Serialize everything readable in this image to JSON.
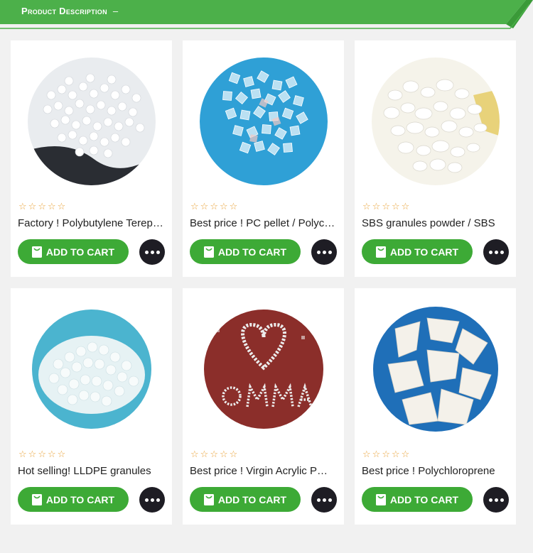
{
  "header": {
    "title": "Product Description",
    "toggle": "–"
  },
  "products": [
    {
      "title": "Factory ! Polybutylene Terephthalate",
      "rating": 0,
      "cart_label": "ADD TO CART",
      "image": "white-pellets"
    },
    {
      "title": "Best price ! PC pellet / Polycarbonate",
      "rating": 0,
      "cart_label": "ADD TO CART",
      "image": "clear-pellets-blue"
    },
    {
      "title": "SBS granules powder / SBS",
      "rating": 0,
      "cart_label": "ADD TO CART",
      "image": "white-crumbs-yellow"
    },
    {
      "title": "Hot selling! LLDPE granules",
      "rating": 0,
      "cart_label": "ADD TO CART",
      "image": "translucent-beads-teal"
    },
    {
      "title": "Best price ! Virgin Acrylic PMMA",
      "rating": 0,
      "cart_label": "ADD TO CART",
      "image": "pmma-heart-red"
    },
    {
      "title": "Best price ! Polychloroprene",
      "rating": 0,
      "cart_label": "ADD TO CART",
      "image": "white-flakes-blue"
    }
  ],
  "colors": {
    "accent": "#3daa36",
    "header": "#4cb04a",
    "star": "#e9a33b",
    "more_bg": "#1e1d24"
  }
}
